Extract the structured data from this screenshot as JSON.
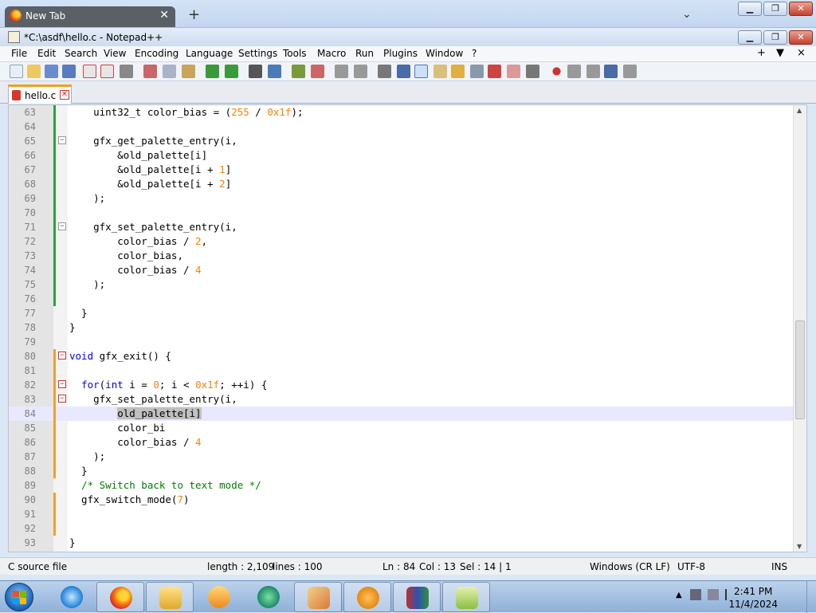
{
  "browser": {
    "tab_title": "New Tab",
    "new_tab_icon": "plus-icon",
    "list_tabs_icon": "chevron-down-icon"
  },
  "window": {
    "title": "*C:\\asdf\\hello.c - Notepad++"
  },
  "menu": {
    "items": [
      "File",
      "Edit",
      "Search",
      "View",
      "Encoding",
      "Language",
      "Settings",
      "Tools",
      "Macro",
      "Run",
      "Plugins",
      "Window",
      "?"
    ],
    "right": [
      "+",
      "▼",
      "×"
    ]
  },
  "tab": {
    "name": "hello.c"
  },
  "editor": {
    "lines": [
      {
        "n": "63",
        "t": [
          {
            "c": "    uint32_t color_bias = (",
            "k": ""
          },
          {
            "c": "255",
            "k": "num"
          },
          {
            "c": " / ",
            "k": ""
          },
          {
            "c": "0x1f",
            "k": "num"
          },
          {
            "c": ");",
            "k": ""
          }
        ]
      },
      {
        "n": "64",
        "t": []
      },
      {
        "n": "65",
        "t": [
          {
            "c": "    gfx_get_palette_entry(i,",
            "k": ""
          }
        ]
      },
      {
        "n": "66",
        "t": [
          {
            "c": "        &old_palette[i]",
            "k": ""
          }
        ]
      },
      {
        "n": "67",
        "t": [
          {
            "c": "        &old_palette[i + ",
            "k": ""
          },
          {
            "c": "1",
            "k": "num"
          },
          {
            "c": "]",
            "k": ""
          }
        ]
      },
      {
        "n": "68",
        "t": [
          {
            "c": "        &old_palette[i + ",
            "k": ""
          },
          {
            "c": "2",
            "k": "num"
          },
          {
            "c": "]",
            "k": ""
          }
        ]
      },
      {
        "n": "69",
        "t": [
          {
            "c": "    );",
            "k": ""
          }
        ]
      },
      {
        "n": "70",
        "t": []
      },
      {
        "n": "71",
        "t": [
          {
            "c": "    gfx_set_palette_entry(i,",
            "k": ""
          }
        ]
      },
      {
        "n": "72",
        "t": [
          {
            "c": "        color_bias / ",
            "k": ""
          },
          {
            "c": "2",
            "k": "num"
          },
          {
            "c": ",",
            "k": ""
          }
        ]
      },
      {
        "n": "73",
        "t": [
          {
            "c": "        color_bias,",
            "k": ""
          }
        ]
      },
      {
        "n": "74",
        "t": [
          {
            "c": "        color_bias / ",
            "k": ""
          },
          {
            "c": "4",
            "k": "num"
          }
        ]
      },
      {
        "n": "75",
        "t": [
          {
            "c": "    );",
            "k": ""
          }
        ]
      },
      {
        "n": "76",
        "t": []
      },
      {
        "n": "77",
        "t": [
          {
            "c": "  }",
            "k": ""
          }
        ]
      },
      {
        "n": "78",
        "t": [
          {
            "c": "}",
            "k": ""
          }
        ]
      },
      {
        "n": "79",
        "t": []
      },
      {
        "n": "80",
        "t": [
          {
            "c": "void",
            "k": "kw"
          },
          {
            "c": " gfx_exit() {",
            "k": ""
          }
        ]
      },
      {
        "n": "81",
        "t": []
      },
      {
        "n": "82",
        "t": [
          {
            "c": "  ",
            "k": ""
          },
          {
            "c": "for",
            "k": "kw"
          },
          {
            "c": "(",
            "k": ""
          },
          {
            "c": "int",
            "k": "kw"
          },
          {
            "c": " i = ",
            "k": ""
          },
          {
            "c": "0",
            "k": "num"
          },
          {
            "c": "; i < ",
            "k": ""
          },
          {
            "c": "0x1f",
            "k": "num"
          },
          {
            "c": "; ++i) {",
            "k": ""
          }
        ]
      },
      {
        "n": "83",
        "t": [
          {
            "c": "    gfx_set_palette_entry(i,",
            "k": ""
          }
        ]
      },
      {
        "n": "84",
        "t": [
          {
            "c": "        ",
            "k": ""
          },
          {
            "c": "old_palette[i]",
            "k": "sel"
          }
        ]
      },
      {
        "n": "85",
        "t": [
          {
            "c": "        color_bi",
            "k": ""
          }
        ]
      },
      {
        "n": "86",
        "t": [
          {
            "c": "        color_bias / ",
            "k": ""
          },
          {
            "c": "4",
            "k": "num"
          }
        ]
      },
      {
        "n": "87",
        "t": [
          {
            "c": "    );",
            "k": ""
          }
        ]
      },
      {
        "n": "88",
        "t": [
          {
            "c": "  }",
            "k": ""
          }
        ]
      },
      {
        "n": "89",
        "t": [
          {
            "c": "  /* Switch back to text mode */",
            "k": "cm"
          }
        ]
      },
      {
        "n": "90",
        "t": [
          {
            "c": "  gfx_switch_mode(",
            "k": ""
          },
          {
            "c": "7",
            "k": "num"
          },
          {
            "c": ")",
            "k": ""
          }
        ]
      },
      {
        "n": "91",
        "t": []
      },
      {
        "n": "92",
        "t": []
      },
      {
        "n": "93",
        "t": [
          {
            "c": "}",
            "k": ""
          }
        ]
      }
    ],
    "current_line": "84",
    "saved_lines": [
      "63",
      "64",
      "65",
      "66",
      "67",
      "68",
      "69",
      "70",
      "71",
      "72",
      "73",
      "74",
      "75",
      "76"
    ],
    "modified_lines": [
      "80",
      "81",
      "82",
      "83",
      "84",
      "85",
      "86",
      "87",
      "88",
      "90",
      "91",
      "92"
    ],
    "change_colors": {
      "saved": "#2ea043",
      "modified": "#f0a030"
    }
  },
  "status": {
    "filetype": "C source file",
    "length": "length : 2,109",
    "lines": "lines : 100",
    "ln": "Ln : 84",
    "col": "Col : 13",
    "sel": "Sel : 14 | 1",
    "eol": "Windows (CR LF)",
    "enc": "UTF-8",
    "mode": "INS"
  },
  "taskbar": {
    "apps": [
      "internet-explorer-icon",
      "firefox-icon",
      "explorer-icon",
      "media-player-icon",
      "messenger-icon",
      "paint-icon",
      "scratch-icon",
      "winrar-icon",
      "notepadpp-icon"
    ],
    "time": "2:41 PM",
    "date": "11/4/2024"
  }
}
